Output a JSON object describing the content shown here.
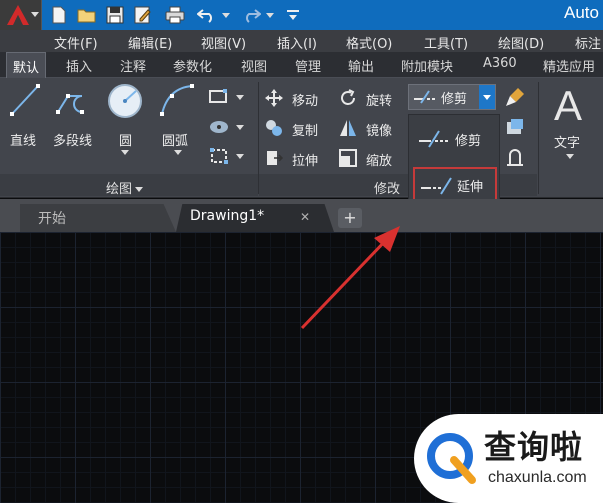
{
  "window": {
    "title": "Auto"
  },
  "quick_access": {
    "icons": [
      "new-file-icon",
      "open-folder-icon",
      "save-icon",
      "save-as-icon",
      "print-icon",
      "undo-icon",
      "redo-icon",
      "customize-icon"
    ]
  },
  "menu": {
    "items": [
      "文件(F)",
      "编辑(E)",
      "视图(V)",
      "插入(I)",
      "格式(O)",
      "工具(T)",
      "绘图(D)",
      "标注"
    ]
  },
  "ribbon_tabs": {
    "items": [
      "默认",
      "插入",
      "注释",
      "参数化",
      "视图",
      "管理",
      "输出",
      "附加模块",
      "A360",
      "精选应用"
    ]
  },
  "draw_panel": {
    "title": "绘图",
    "line": "直线",
    "polyline": "多段线",
    "circle": "圆",
    "arc": "圆弧"
  },
  "modify_panel": {
    "title": "修改",
    "move": "移动",
    "rotate": "旋转",
    "copy": "复制",
    "mirror": "镜像",
    "stretch": "拉伸",
    "scale": "缩放",
    "trim": "修剪"
  },
  "trim_dropdown": {
    "items": [
      "修剪",
      "延伸"
    ],
    "highlighted": "延伸"
  },
  "annotation_panel": {
    "text": "文字",
    "big_letter": "A"
  },
  "doc_tabs": {
    "start": "开始",
    "drawing": "Drawing1*",
    "close": "✕",
    "add": "+"
  },
  "watermark": {
    "cn": "查询啦",
    "en": "chaxunla.com"
  },
  "colors": {
    "title_blue": "#0f6cbd",
    "highlight_red": "#c53a3a",
    "arrow_red": "#d9312f"
  }
}
